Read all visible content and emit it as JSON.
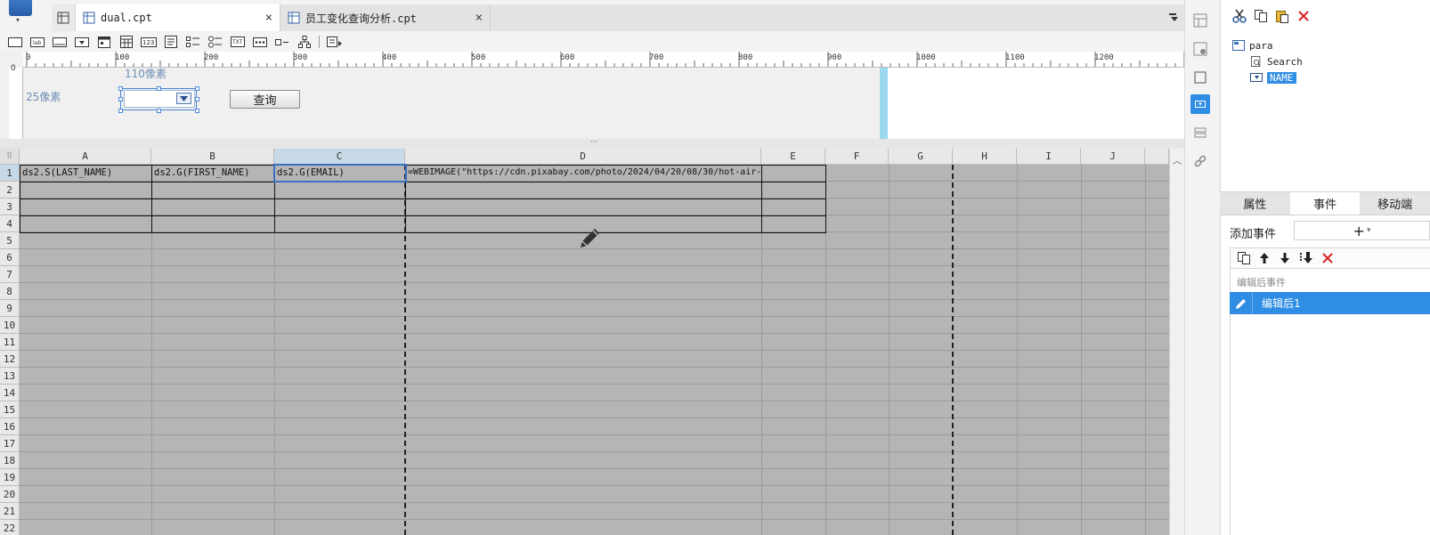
{
  "tabs": [
    {
      "label": "dual.cpt",
      "close": "×"
    },
    {
      "label": "员工变化查询分析.cpt",
      "close": "×"
    }
  ],
  "toolbar": {
    "items": [
      "label-widget",
      "text-widget",
      "combo-widget",
      "date-widget",
      "calendar-widget",
      "number-widget",
      "textarea-widget",
      "checkgroup-widget",
      "radiogroup-widget",
      "text-area-box",
      "password-widget",
      "checkbox-widget",
      "tree-widget",
      "list-widget"
    ]
  },
  "ruler": {
    "labels": [
      "0",
      "100",
      "200",
      "300",
      "400",
      "500",
      "600",
      "700",
      "800",
      "900",
      "1000",
      "1100",
      "1200"
    ],
    "vertical_zero": "0"
  },
  "param_panel": {
    "width_label": "110像素",
    "height_label": "25像素",
    "query_button": "查询",
    "splitter": "···"
  },
  "sheet": {
    "columns": [
      "A",
      "B",
      "C",
      "D",
      "E",
      "F",
      "G",
      "H",
      "I",
      "J"
    ],
    "rows": [
      "1",
      "2",
      "3",
      "4",
      "5",
      "6",
      "7",
      "8",
      "9",
      "10",
      "11",
      "12",
      "13",
      "14",
      "15",
      "16",
      "17",
      "18",
      "19",
      "20",
      "21",
      "22"
    ],
    "cells": {
      "A1": "ds2.S(LAST_NAME)",
      "B1": "ds2.G(FIRST_NAME)",
      "C1": "ds2.G(EMAIL)",
      "D1": "=WEBIMAGE(\"https://cdn.pixabay.com/photo/2024/04/20/08/30/hot-air-"
    },
    "selected_cell": "C1",
    "selected_column": "C"
  },
  "tree": {
    "root": "para",
    "children": [
      "Search",
      "NAME"
    ],
    "selected": "NAME"
  },
  "right_tabs": [
    "属性",
    "事件",
    "移动端"
  ],
  "active_right_tab": "事件",
  "events": {
    "add_label": "添加事件",
    "add_button": "+",
    "add_caret": "▾",
    "group_label": "编辑后事件",
    "items": [
      "编辑后1"
    ]
  },
  "colors": {
    "accent": "#2f8de4",
    "sheet_bg": "#b5b5b5",
    "selection": "#3a6fc2",
    "resizer": "#9ad9ee"
  }
}
